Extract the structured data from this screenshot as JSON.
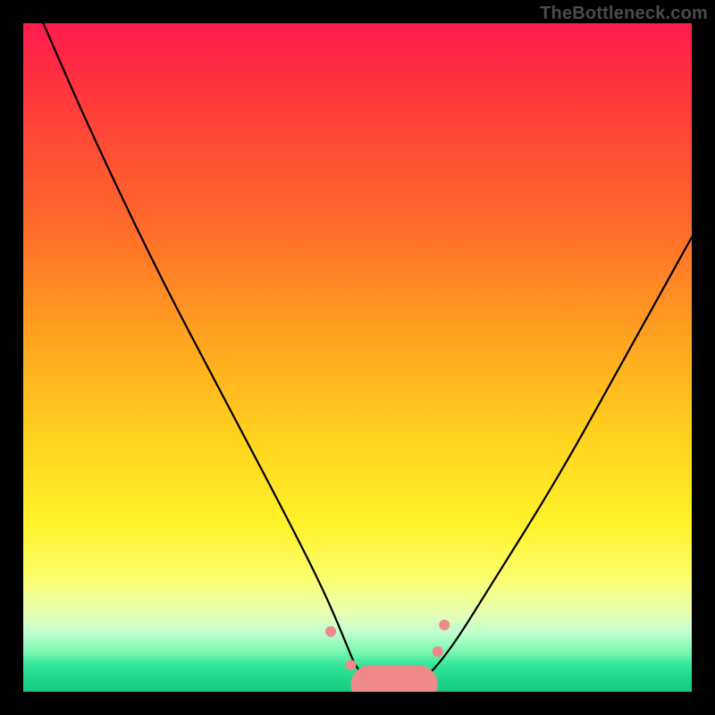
{
  "watermark": "TheBottleneck.com",
  "chart_data": {
    "type": "line",
    "title": "",
    "xlabel": "",
    "ylabel": "",
    "xlim": [
      0,
      100
    ],
    "ylim": [
      0,
      100
    ],
    "grid": false,
    "legend": false,
    "series": [
      {
        "name": "bottleneck-curve",
        "color": "#000000",
        "x": [
          3,
          10,
          20,
          30,
          40,
          45,
          48,
          50,
          53,
          56,
          58,
          60,
          62,
          65,
          70,
          80,
          90,
          100
        ],
        "y": [
          100,
          84,
          63,
          44,
          25,
          15,
          8,
          3,
          1,
          1,
          1,
          2,
          4,
          8,
          16,
          32,
          50,
          68
        ]
      }
    ],
    "markers": [
      {
        "name": "pink-marker-left-1",
        "x": 46,
        "y": 9,
        "r": 6,
        "color": "#f08a8a"
      },
      {
        "name": "pink-marker-left-2",
        "x": 49,
        "y": 4,
        "r": 6,
        "color": "#f08a8a"
      },
      {
        "name": "pink-marker-bottom-left",
        "x": 51,
        "y": 2,
        "r": 5,
        "color": "#f08a8a"
      },
      {
        "name": "pink-marker-mid-1",
        "x": 54,
        "y": 1,
        "r": 5,
        "color": "#f08a8a"
      },
      {
        "name": "pink-marker-mid-2",
        "x": 57,
        "y": 1,
        "r": 5,
        "color": "#f08a8a"
      },
      {
        "name": "pink-marker-bottom-right",
        "x": 59,
        "y": 2,
        "r": 5,
        "color": "#f08a8a"
      },
      {
        "name": "pink-marker-right-1",
        "x": 62,
        "y": 6,
        "r": 6,
        "color": "#f08a8a"
      },
      {
        "name": "pink-marker-right-2",
        "x": 63,
        "y": 10,
        "r": 6,
        "color": "#f08a8a"
      }
    ],
    "bottom_band": {
      "name": "pink-band",
      "x0": 52,
      "x1": 59,
      "y": 1,
      "thickness": 3,
      "color": "#f08a8a"
    }
  }
}
